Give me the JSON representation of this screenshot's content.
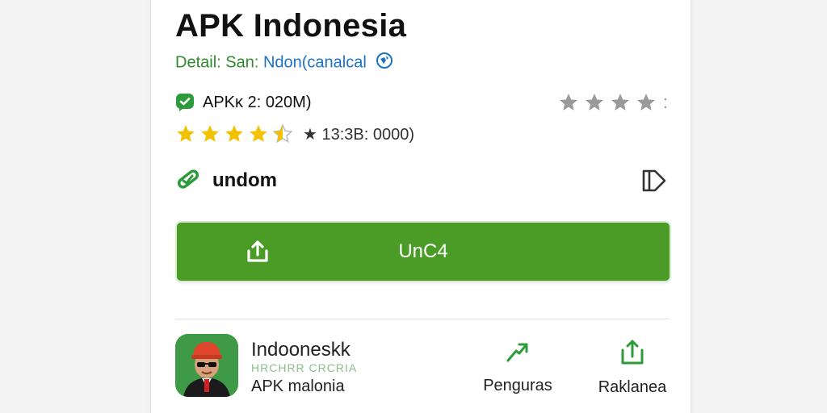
{
  "app": {
    "title": "APK Indonesia",
    "detail_label": "Detail: San:",
    "detail_value": "Ndon(canalcal",
    "size_text": "APKĸ 2: 020M)",
    "rating_text": "★ 13:3B: 0000)",
    "star_rating": 4.5,
    "tag_label": "undom",
    "download_button": "UnC4"
  },
  "related": {
    "name": "Indooneskk",
    "subtitle": "HRCHRR CRCRIA",
    "description": "APK malonia",
    "actions": [
      {
        "label": "Penguras",
        "icon": "share-arrow-icon"
      },
      {
        "label": "Raklanea",
        "icon": "share-upload-icon"
      }
    ]
  },
  "colors": {
    "brand_green": "#4a9c26",
    "star_yellow": "#f2c200",
    "star_gray": "#9a9a9a",
    "link_blue": "#1a73c8",
    "label_green": "#2e8b2e"
  }
}
